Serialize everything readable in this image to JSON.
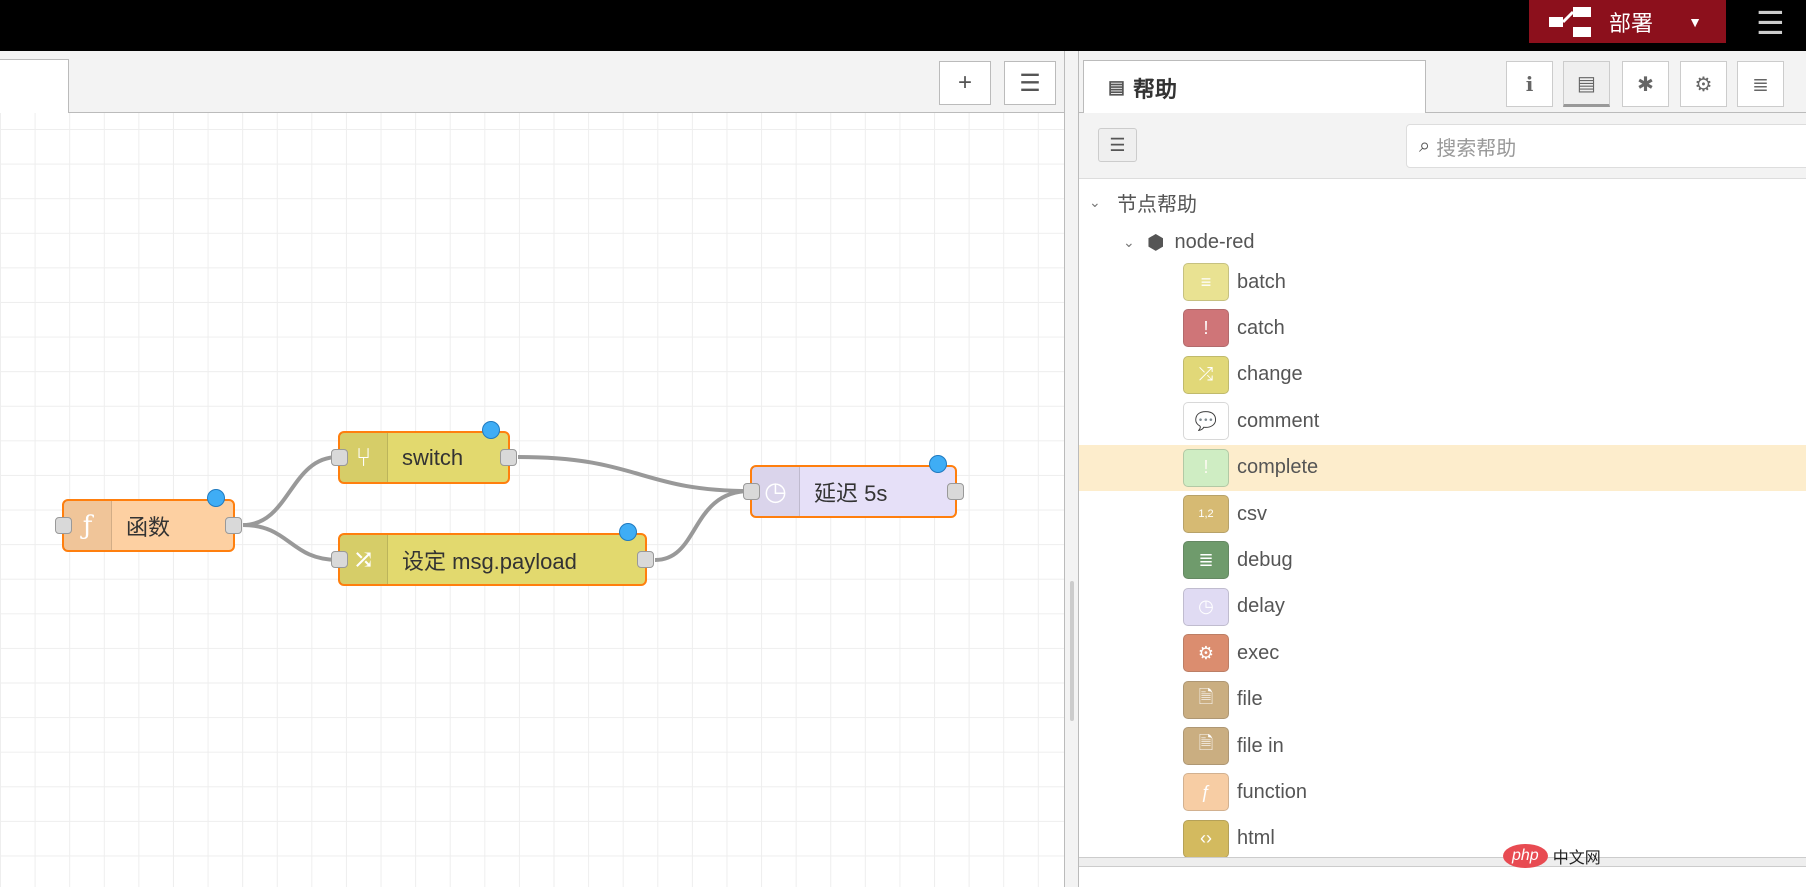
{
  "header": {
    "deploy_label": "部署",
    "deploy_icon": "deploy-icon",
    "menu_icon": "hamburger-icon"
  },
  "canvas": {
    "toolbar": {
      "add_label": "+",
      "list_label": "☰"
    },
    "nodes": [
      {
        "id": "fn",
        "label": "函数",
        "type": "function",
        "color": "#fdd0a2",
        "icon": "ƒ"
      },
      {
        "id": "sw",
        "label": "switch",
        "type": "switch",
        "color": "#e2d96e",
        "icon": "⑂"
      },
      {
        "id": "ch",
        "label": "设定 msg.payload",
        "type": "change",
        "color": "#e2d96e",
        "icon": "⤮"
      },
      {
        "id": "dl",
        "label": "延迟 5s",
        "type": "delay",
        "color": "#e6e0f8",
        "icon": "◷"
      }
    ]
  },
  "sidebar": {
    "tab_title": "帮助",
    "tab_buttons": [
      {
        "name": "info",
        "glyph": "i"
      },
      {
        "name": "help",
        "glyph": "▤"
      },
      {
        "name": "debug",
        "glyph": "✱"
      },
      {
        "name": "config",
        "glyph": "⚙"
      },
      {
        "name": "context",
        "glyph": "≣"
      }
    ],
    "search_placeholder": "搜索帮助",
    "tree_root": "节点帮助",
    "tree_module": "node-red",
    "items": [
      {
        "label": "batch",
        "color": "#e2d96e",
        "glyph": "≡"
      },
      {
        "label": "catch",
        "color": "#c0484b",
        "glyph": "!"
      },
      {
        "label": "change",
        "color": "#d8cc4c",
        "glyph": "⤮"
      },
      {
        "label": "comment",
        "color": "#ffffff",
        "glyph": "💬"
      },
      {
        "label": "complete",
        "color": "#c0edc0",
        "glyph": "!"
      },
      {
        "label": "csv",
        "color": "#c9a445",
        "glyph": "1,2"
      },
      {
        "label": "debug",
        "color": "#3f7a3b",
        "glyph": "≣"
      },
      {
        "label": "delay",
        "color": "#d6d0f0",
        "glyph": "◷"
      },
      {
        "label": "exec",
        "color": "#d0683f",
        "glyph": "⚙"
      },
      {
        "label": "file",
        "color": "#b99358",
        "glyph": "🗎"
      },
      {
        "label": "file in",
        "color": "#b99358",
        "glyph": "🗎"
      },
      {
        "label": "function",
        "color": "#f5bd86",
        "glyph": "ƒ"
      },
      {
        "label": "html",
        "color": "#c5a32a",
        "glyph": "‹›"
      }
    ],
    "highlighted": "complete"
  },
  "watermark": {
    "brand": "php",
    "text": "中文网"
  }
}
